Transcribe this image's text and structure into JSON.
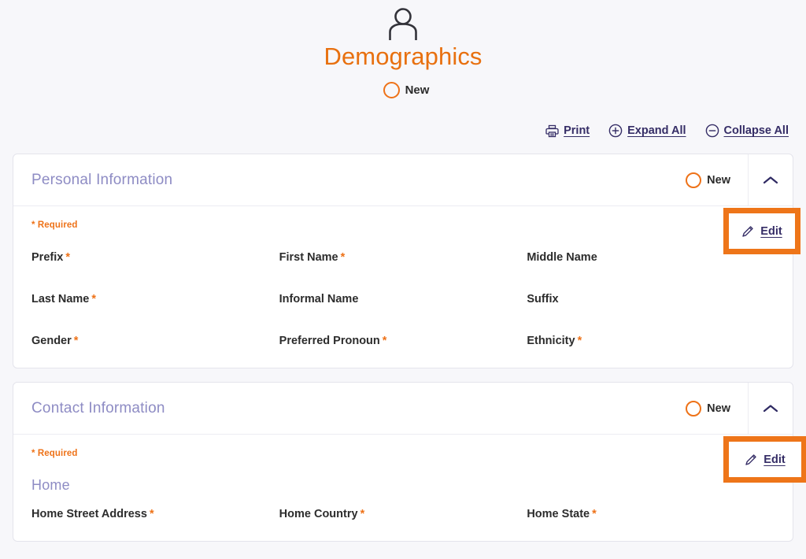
{
  "page": {
    "icon": "person-icon",
    "title": "Demographics",
    "status": "New"
  },
  "toolbar": {
    "print": {
      "icon": "printer-icon",
      "label": "Print"
    },
    "expand_all": {
      "icon": "plus-circle-icon",
      "label": "Expand All"
    },
    "collapse_all": {
      "icon": "minus-circle-icon",
      "label": "Collapse All"
    }
  },
  "common": {
    "required_note": "* Required",
    "edit_label": "Edit",
    "edit_icon": "pencil-icon",
    "collapse_icon": "chevron-up-icon"
  },
  "sections": [
    {
      "title": "Personal Information",
      "status": "New",
      "required_note": "* Required",
      "edit_label": "Edit",
      "fields": [
        {
          "label": "Prefix",
          "required": true
        },
        {
          "label": "First Name",
          "required": true
        },
        {
          "label": "Middle Name",
          "required": false
        },
        {
          "label": "Last Name",
          "required": true
        },
        {
          "label": "Informal Name",
          "required": false
        },
        {
          "label": "Suffix",
          "required": false
        },
        {
          "label": "Gender",
          "required": true
        },
        {
          "label": "Preferred Pronoun",
          "required": true
        },
        {
          "label": "Ethnicity",
          "required": true
        }
      ]
    },
    {
      "title": "Contact Information",
      "status": "New",
      "required_note": "* Required",
      "edit_label": "Edit",
      "sub_heading": "Home",
      "fields": [
        {
          "label": "Home Street Address",
          "required": true
        },
        {
          "label": "Home Country",
          "required": true
        },
        {
          "label": "Home State",
          "required": true
        }
      ]
    }
  ],
  "colors": {
    "accent_orange": "#ee7218",
    "title_orange": "#e8700f",
    "link_navy": "#352d66",
    "section_purple": "#8e8cc4",
    "page_background": "#f7f7fa",
    "card_background": "#ffffff",
    "highlight_box": "#ee7519"
  }
}
